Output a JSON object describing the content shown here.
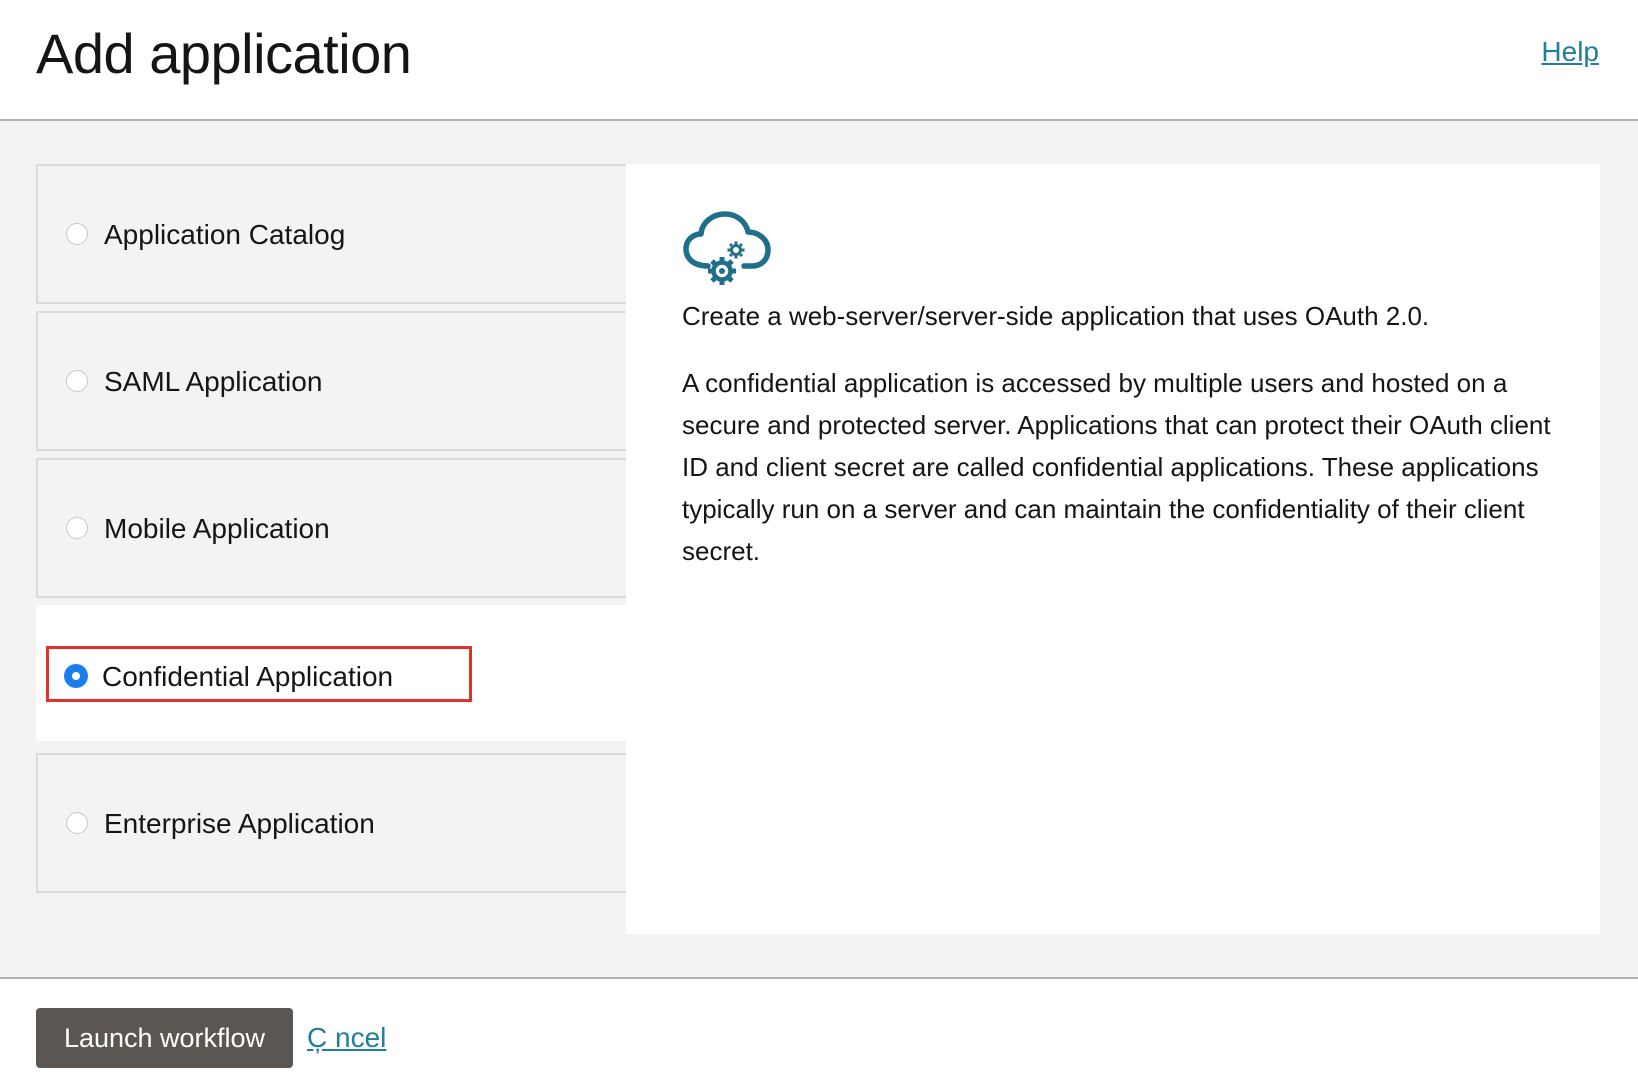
{
  "header": {
    "title": "Add application",
    "help_label": "Help"
  },
  "options": [
    {
      "label": "Application Catalog",
      "selected": false
    },
    {
      "label": "SAML Application",
      "selected": false
    },
    {
      "label": "Mobile Application",
      "selected": false
    },
    {
      "label": "Confidential Application",
      "selected": true
    },
    {
      "label": "Enterprise Application",
      "selected": false
    }
  ],
  "detail": {
    "icon": "cloud-gears-icon",
    "summary": "Create a web-server/server-side application that uses OAuth 2.0.",
    "description": "A confidential application is accessed by multiple users and hosted on a secure and protected server. Applications that can protect their OAuth client ID and client secret are called confidential applications. These applications typically run on a server and can maintain the confidentiality of their client secret."
  },
  "footer": {
    "launch_label": "Launch workflow",
    "cancel_label": "C̦ ncel"
  },
  "colors": {
    "accent_teal": "#227e9e",
    "icon_teal": "#1f6f8b",
    "radio_selected": "#1b7eef",
    "button_bg": "#5b5652",
    "highlight": "#e0322d"
  }
}
